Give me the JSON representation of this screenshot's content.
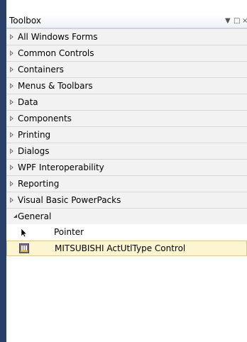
{
  "toolbox": {
    "title": "Toolbox",
    "controls": {
      "dropdown": "▼",
      "maximize": "□",
      "close": "×"
    },
    "categories": [
      {
        "label": "All Windows Forms",
        "expanded": false
      },
      {
        "label": "Common Controls",
        "expanded": false
      },
      {
        "label": "Containers",
        "expanded": false
      },
      {
        "label": "Menus & Toolbars",
        "expanded": false
      },
      {
        "label": "Data",
        "expanded": false
      },
      {
        "label": "Components",
        "expanded": false
      },
      {
        "label": "Printing",
        "expanded": false
      },
      {
        "label": "Dialogs",
        "expanded": false
      },
      {
        "label": "WPF Interoperability",
        "expanded": false
      },
      {
        "label": "Reporting",
        "expanded": false
      },
      {
        "label": "Visual Basic PowerPacks",
        "expanded": false
      },
      {
        "label": "General",
        "expanded": true
      }
    ],
    "general_items": [
      {
        "label": "Pointer",
        "icon": "pointer-arrow-icon",
        "selected": false
      },
      {
        "label": "MITSUBISHI ActUtlType Control",
        "icon": "control-component-icon",
        "selected": true
      }
    ]
  }
}
